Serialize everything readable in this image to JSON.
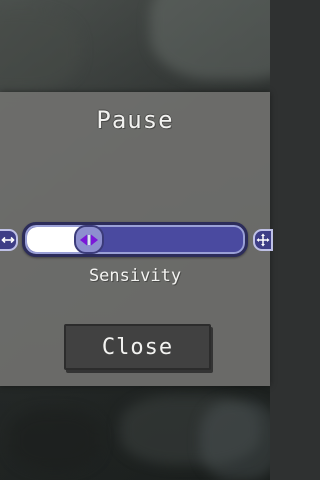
{
  "pause_menu": {
    "title": "Pause",
    "sensitivity": {
      "label": "Sensivity",
      "value_fraction": 0.28,
      "left_icon": "horizontal-arrows-icon",
      "right_icon": "four-way-arrows-icon",
      "thumb_icon": "left-right-arrows-icon",
      "track_color": "#4a4aa0",
      "fill_color": "#ffffff",
      "thumb_color": "#8d8fcf",
      "arrow_color": "#7a18d8"
    },
    "close_label": "Close"
  }
}
